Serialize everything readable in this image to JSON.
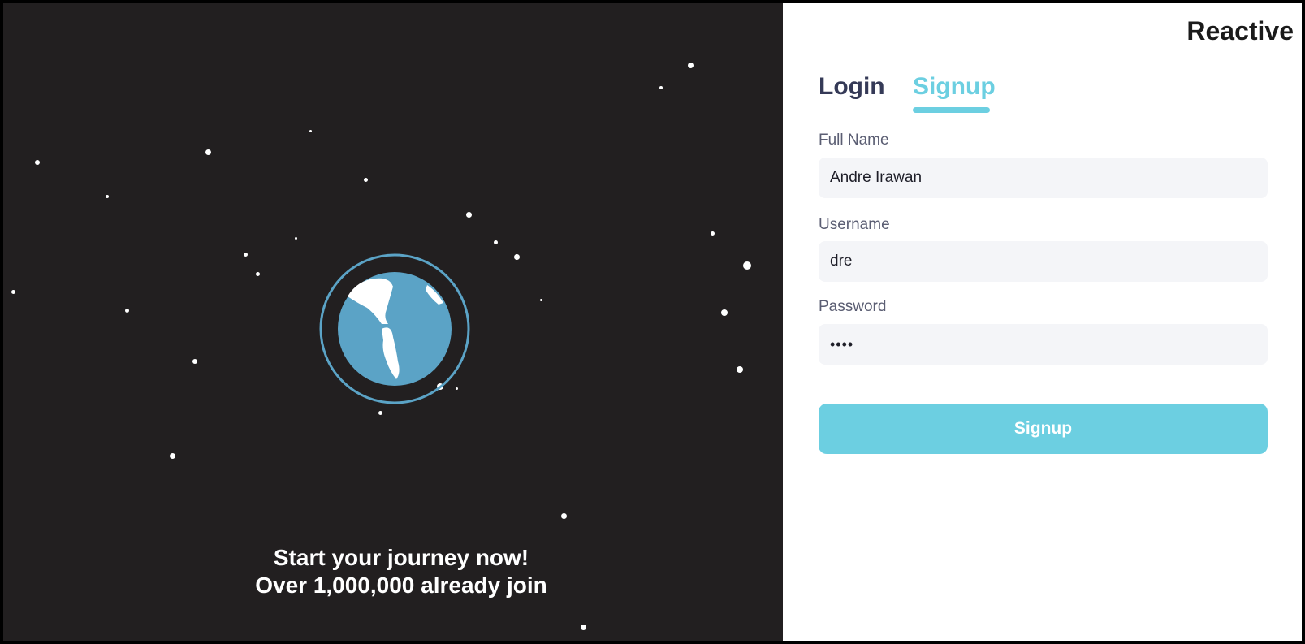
{
  "app": {
    "brand": "Reactive"
  },
  "hero": {
    "tagline_line1": "Start your journey now!",
    "tagline_line2": "Over 1,000,000 already join",
    "illustration": "earth-globe-icon"
  },
  "tabs": {
    "login_label": "Login",
    "signup_label": "Signup",
    "active": "Signup"
  },
  "form": {
    "full_name": {
      "label": "Full Name",
      "value": "Andre Irawan"
    },
    "username": {
      "label": "Username",
      "value": "dre"
    },
    "password": {
      "label": "Password",
      "value": "dree"
    },
    "submit_label": "Signup"
  },
  "colors": {
    "hero_background": "#221f20",
    "accent": "#6ccfe1",
    "globe_ocean": "#5ba3c6",
    "tab_inactive": "#353a57",
    "input_background": "#f4f5f8"
  }
}
